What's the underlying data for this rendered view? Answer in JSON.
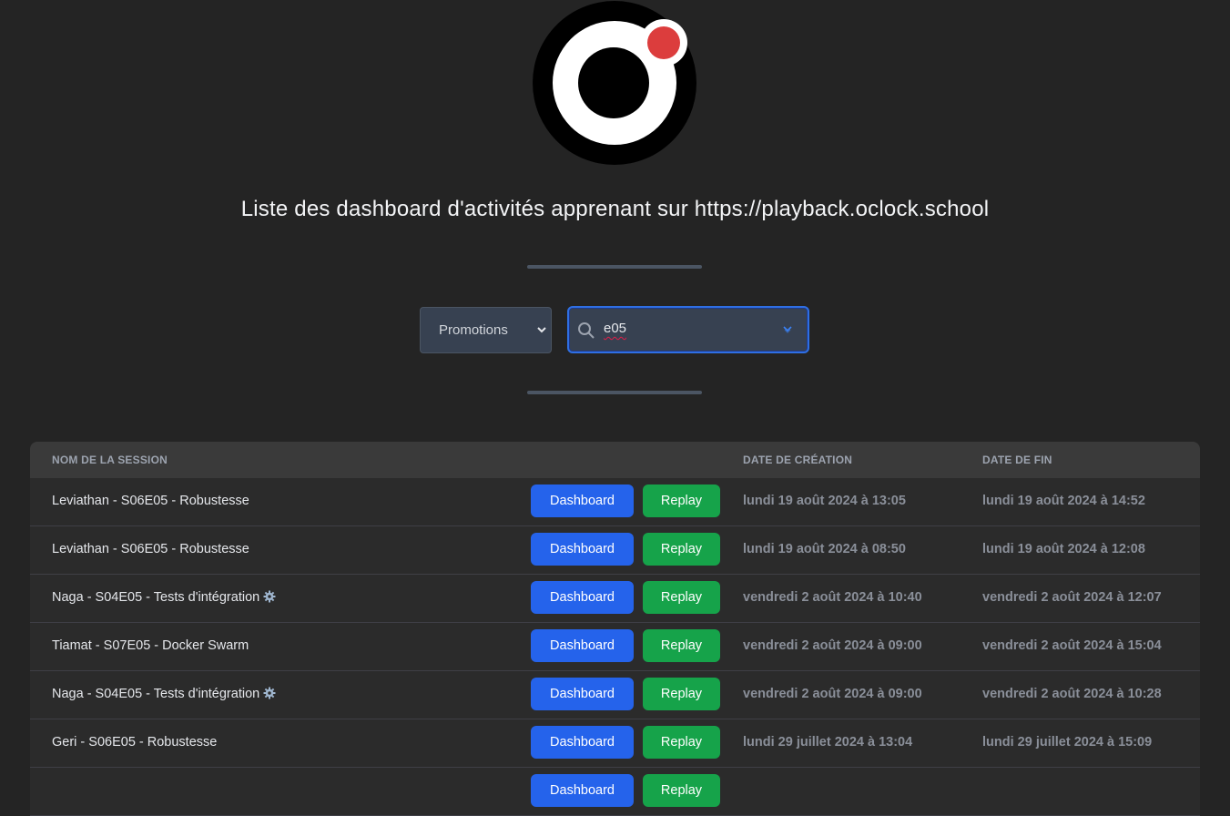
{
  "page_title": "Liste des dashboard d'activités apprenant sur https://playback.oclock.school",
  "filter": {
    "select_value": "Promotions",
    "search_value": "e05"
  },
  "table": {
    "headers": {
      "session": "NOM DE LA SESSION",
      "created": "DATE DE CRÉATION",
      "end": "DATE DE FIN"
    },
    "dashboard_label": "Dashboard",
    "replay_label": "Replay",
    "rows": [
      {
        "name": "Leviathan - S06E05 - Robustesse",
        "gear": false,
        "created": "lundi 19 août 2024 à 13:05",
        "end": "lundi 19 août 2024 à 14:52"
      },
      {
        "name": "Leviathan - S06E05 - Robustesse",
        "gear": false,
        "created": "lundi 19 août 2024 à 08:50",
        "end": "lundi 19 août 2024 à 12:08"
      },
      {
        "name": "Naga - S04E05 - Tests d'intégration",
        "gear": true,
        "created": "vendredi 2 août 2024 à 10:40",
        "end": "vendredi 2 août 2024 à 12:07"
      },
      {
        "name": "Tiamat - S07E05 - Docker Swarm",
        "gear": false,
        "created": "vendredi 2 août 2024 à 09:00",
        "end": "vendredi 2 août 2024 à 15:04"
      },
      {
        "name": "Naga - S04E05 - Tests d'intégration",
        "gear": true,
        "created": "vendredi 2 août 2024 à 09:00",
        "end": "vendredi 2 août 2024 à 10:28"
      },
      {
        "name": "Geri - S06E05 - Robustesse",
        "gear": false,
        "created": "lundi 29 juillet 2024 à 13:04",
        "end": "lundi 29 juillet 2024 à 15:09"
      },
      {
        "name": "",
        "gear": false,
        "created": "",
        "end": ""
      }
    ]
  }
}
